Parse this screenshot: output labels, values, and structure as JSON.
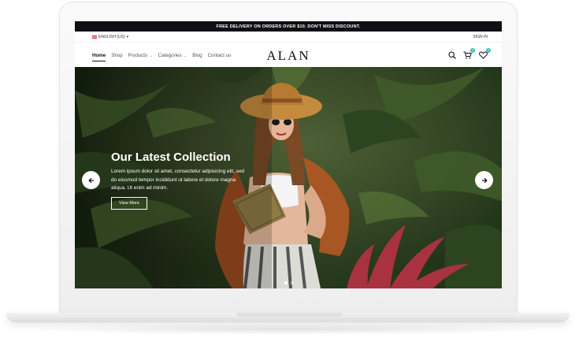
{
  "promo": {
    "text": "FREE DELIVERY ON ORDERS OVER $10. DON'T MISS DISCOUNT."
  },
  "topbar": {
    "language": "ENGLISH (US)",
    "sign_in": "SIGN IN"
  },
  "nav": {
    "links": [
      {
        "label": "Home",
        "active": true
      },
      {
        "label": "Shop"
      },
      {
        "label": "Products",
        "dropdown": true
      },
      {
        "label": "Categories",
        "dropdown": true
      },
      {
        "label": "Blog"
      },
      {
        "label": "Contact us"
      }
    ],
    "logo": "ALAN",
    "cart_count": "0",
    "wishlist_count": "0"
  },
  "hero": {
    "title": "Our Latest Collection",
    "text": "Lorem ipsum dolor sit amet, consectetur adipisicing elit, sed do eiusmod tempor incididunt ut labore et dolore magna aliqua. Ut enim ad minim.",
    "button_label": "View More",
    "slide_count": 2,
    "active_slide": 1
  },
  "icons": {
    "search": "search-icon",
    "cart": "cart-icon",
    "wishlist": "heart-icon",
    "prev": "arrow-left-icon",
    "next": "arrow-right-icon"
  },
  "colors": {
    "promo_bg": "#0f0f14",
    "badge": "#35c2b0"
  }
}
